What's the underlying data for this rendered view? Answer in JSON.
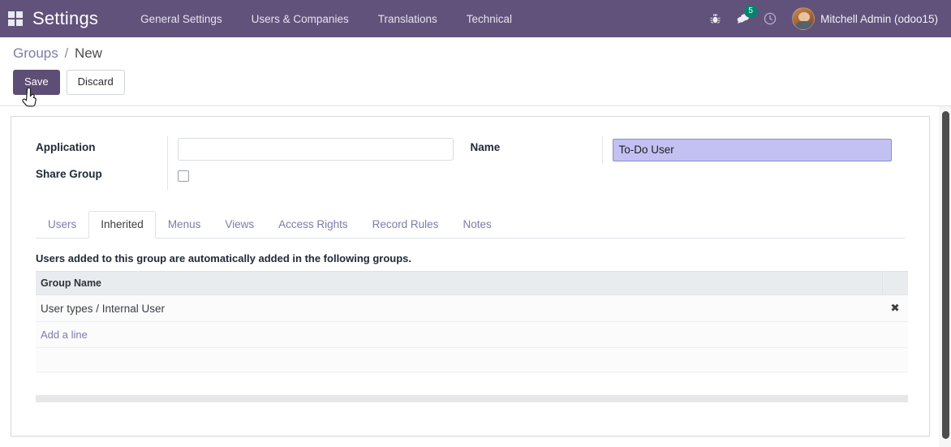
{
  "navbar": {
    "apps_icon": "apps-grid-icon",
    "brand": "Settings",
    "menu": [
      {
        "label": "General Settings"
      },
      {
        "label": "Users & Companies"
      },
      {
        "label": "Translations"
      },
      {
        "label": "Technical"
      }
    ],
    "icons": [
      {
        "name": "bug-icon",
        "glyph": "⚙"
      },
      {
        "name": "messages-icon",
        "glyph": "●"
      },
      {
        "name": "activities-clock-icon",
        "glyph": "○"
      }
    ],
    "messages_badge": "5",
    "user": "Mitchell Admin (odoo15)",
    "colors": {
      "navbar_bg": "#61527b",
      "badge_bg": "#00866e"
    }
  },
  "control_panel": {
    "breadcrumb_root": "Groups",
    "breadcrumb_sep": "/",
    "breadcrumb_current": "New",
    "save_label": "Save",
    "discard_label": "Discard"
  },
  "form": {
    "application": {
      "label": "Application",
      "value": "",
      "placeholder": ""
    },
    "share_group": {
      "label": "Share Group",
      "checked": false
    },
    "name": {
      "label": "Name",
      "value": "To-Do User",
      "selected": true,
      "highlight_color": "#c3c1f2"
    }
  },
  "notebook": {
    "tabs": [
      {
        "label": "Users",
        "active": false
      },
      {
        "label": "Inherited",
        "active": true
      },
      {
        "label": "Menus",
        "active": false
      },
      {
        "label": "Views",
        "active": false
      },
      {
        "label": "Access Rights",
        "active": false
      },
      {
        "label": "Record Rules",
        "active": false
      },
      {
        "label": "Notes",
        "active": false
      }
    ],
    "inherited": {
      "hint": "Users added to this group are automatically added in the following groups.",
      "columns": [
        "Group Name",
        ""
      ],
      "rows": [
        {
          "group_name": "User types / Internal User",
          "delete_glyph": "✖"
        }
      ],
      "add_line_label": "Add a line"
    }
  },
  "scrollbars": {
    "vertical": "visible",
    "horizontal": "visible"
  }
}
